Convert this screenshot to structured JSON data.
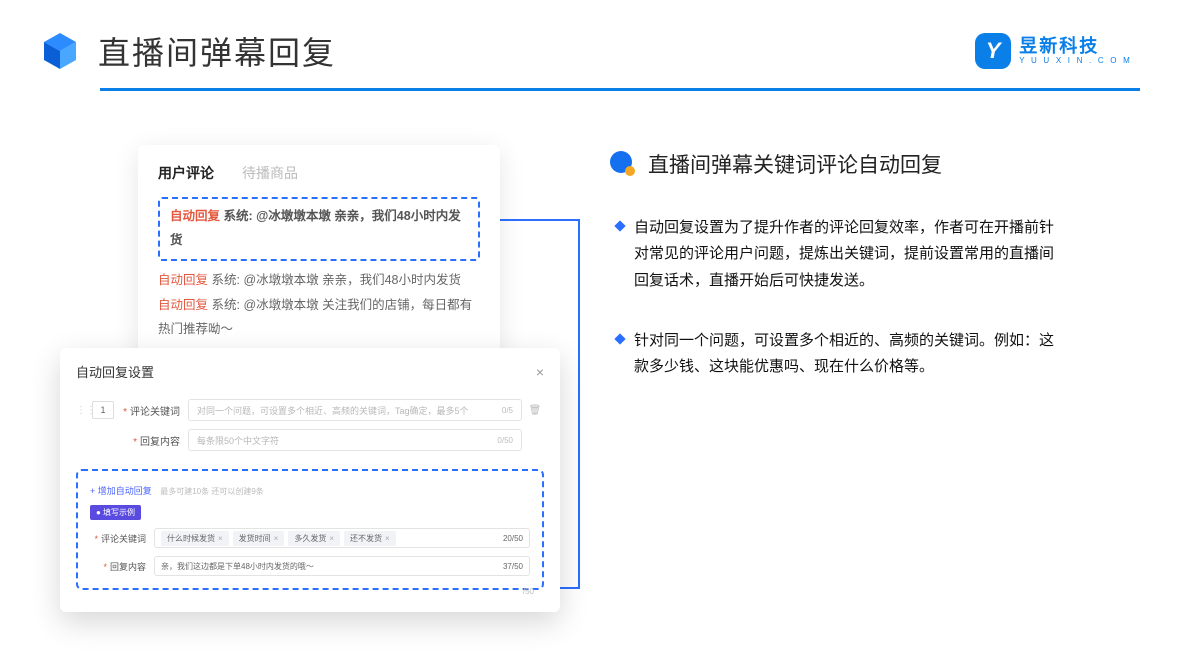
{
  "header": {
    "title": "直播间弹幕回复",
    "brand_cn": "昱新科技",
    "brand_en": "Y U U X I N . C O M",
    "brand_mark": "Y"
  },
  "comments": {
    "tabs": {
      "active": "用户评论",
      "inactive": "待播商品"
    },
    "items": [
      {
        "tag": "自动回复",
        "text": "系统: @冰墩墩本墩 亲亲，我们48小时内发货"
      },
      {
        "tag": "自动回复",
        "text": "系统: @冰墩墩本墩 亲亲，我们48小时内发货"
      },
      {
        "tag": "自动回复",
        "text": "系统: @冰墩墩本墩 关注我们的店铺，每日都有热门推荐呦～"
      }
    ]
  },
  "modal": {
    "title": "自动回复设置",
    "close": "×",
    "index": "1",
    "row1": {
      "label": "评论关键词",
      "placeholder": "对同一个问题，可设置多个相近、高频的关键词，Tag确定，最多5个",
      "count": "0/5"
    },
    "row2": {
      "label": "回复内容",
      "placeholder": "每条限50个中文字符",
      "count": "0/50"
    },
    "add_link": "+ 增加自动回复",
    "add_caption": "最多可建10条 还可以创建9条",
    "badge": "● 填写示例",
    "ex1": {
      "label": "评论关键词",
      "tags": [
        "什么时候发货",
        "发货时间",
        "多久发货",
        "还不发货"
      ],
      "count": "20/50"
    },
    "ex2": {
      "label": "回复内容",
      "value": "亲，我们这边都是下单48小时内发货的哦～",
      "count": "37/50"
    },
    "extra_count": "/50"
  },
  "section": {
    "title": "直播间弹幕关键词评论自动回复",
    "bullets": [
      "自动回复设置为了提升作者的评论回复效率，作者可在开播前针对常见的评论用户问题，提炼出关键词，提前设置常用的直播间回复话术，直播开始后可快捷发送。",
      "针对同一个问题，可设置多个相近的、高频的关键词。例如：这款多少钱、这块能优惠吗、现在什么价格等。"
    ]
  }
}
